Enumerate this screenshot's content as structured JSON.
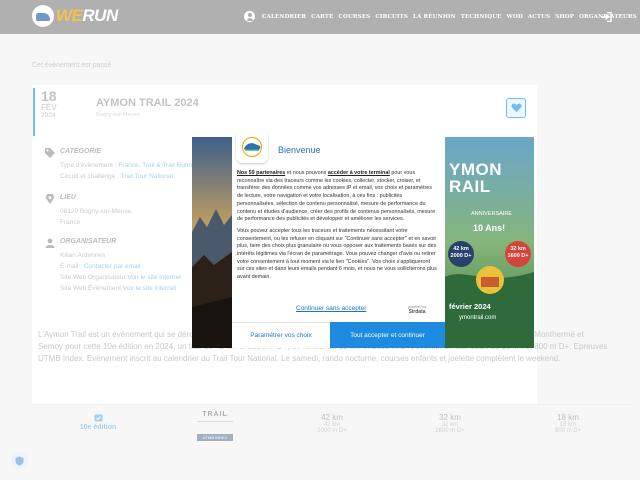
{
  "header": {
    "logo_we": "WE",
    "logo_run": "RUN",
    "nav": [
      "Calendrier",
      "Carte",
      "Courses",
      "Circuits",
      "La Réunion",
      "Technique",
      "WOD",
      "Actus",
      "Shop",
      "Organisateurs"
    ]
  },
  "notice": "Cet évènement est passé",
  "event": {
    "day": "18",
    "month": "FÉV",
    "year": "2024",
    "title": "AYMON TRAIL 2024",
    "location_sub": "Bogny-sur-Meuse"
  },
  "categorie": {
    "title": "Catégorie",
    "type_label": "Type d'évènement : ",
    "type_values": "France, Trail & Trail Running",
    "circuit_label": "Circuit et challenge : ",
    "circuit_value": "Trail Tour National"
  },
  "lieu": {
    "title": "Lieu",
    "postal": "08120 Bogny-sur-Meuse",
    "country": "France"
  },
  "organisateur": {
    "title": "Organisateur",
    "name": "Kilian Ardennes",
    "email_label": "E-mail : ",
    "email_link": "Contacter par email",
    "site_label": "Site Web Organisateur ",
    "site_link": "Voir le site internet",
    "site_event_label": "Site Web Évènement ",
    "site_event_link": "Voir le site internet"
  },
  "description": "L'Aymon Trail est un évènement qui se déroule dans les Ardennes, sur les communes de Bogny-sur-Meuse. 3 courses au programme entre Monthermé et Semoy pour cette 10e édition en 2024, un trail de 42 km et 2000 m D+, un format de 32 km et 1600 m D+, et enfin un trail court de 18 km et 800 m D+. Epreuves UTMB Index. Evènement inscrit au calendrier du Trail Tour National. Le samedi, rando nocturne, courses enfants et joelette complètent le weekend.",
  "stats": {
    "edition": "10e édition",
    "trail_logo": "TRAIL",
    "utmb": "UTMB INDEX",
    "races": [
      {
        "big": "42 km",
        "km": "42 km",
        "dplus": "2000 m D+"
      },
      {
        "big": "32 km",
        "km": "32 km",
        "dplus": "1600 m D+"
      },
      {
        "big": "18 km",
        "km": "18 km",
        "dplus": "800 m D+"
      }
    ]
  },
  "modal": {
    "title": "Bienvenue",
    "body_p1_strong": "Nos 59 partenaires",
    "body_p1_mid": " et nous pouvons ",
    "body_p1_link": "accéder à votre terminal",
    "body_p1_rest": " pour vous reconnaître via des traceurs comme les cookies, collecter, stocker, croiser, et transférer des données comme vos adresses IP et email, vos choix et paramètres de lecture, votre navigation et votre localisation, à ces fins : publicités personnalisées, sélection de contenu personnalisé, mesure de performance du contenu et études d'audience, créer des profils de contenus personnalisés, mesure de performance des publicités et développer et améliorer les services.",
    "body_p2": "Vous pouvez accepter tous les traceurs et traitements nécessitant votre consentement, ou les refuser en cliquant sur \"Continuer sans accepter\" et en savoir plus, faire des choix plus granulaire ou vous opposer aux traitements basés sur des intérêts légitimes via l'écran de paramétrage. Vous pouvez changer d'avis ou retirer votre consentement à tout moment via le lien \"Cookies\". Vos choix s'appliqueront sur ces sites et dans leurs emails pendant 6 mois, et nous ne vous solliciterons plus avant demain.",
    "continue_link": "Continuer sans accepter",
    "powered_by": "powered by",
    "didomi": "Sirdata",
    "btn_params": "Paramétrer vos choix",
    "btn_accept": "Tout accepter et continuer"
  },
  "poster": {
    "line1": "YMON",
    "line2": "RAIL",
    "anniv": "ANNIVERSAIRE",
    "ans": "10 Ans!",
    "badge1_km": "42 km",
    "badge1_d": "2000 D+",
    "badge2_km": "32 km",
    "badge2_d": "1600 D+",
    "date": "février 2024",
    "url": "ymontrail.com"
  },
  "colors": {
    "accent": "#2ea3f2",
    "modal_blue": "#1e8ae0",
    "header_bg": "#8f8f8f"
  }
}
